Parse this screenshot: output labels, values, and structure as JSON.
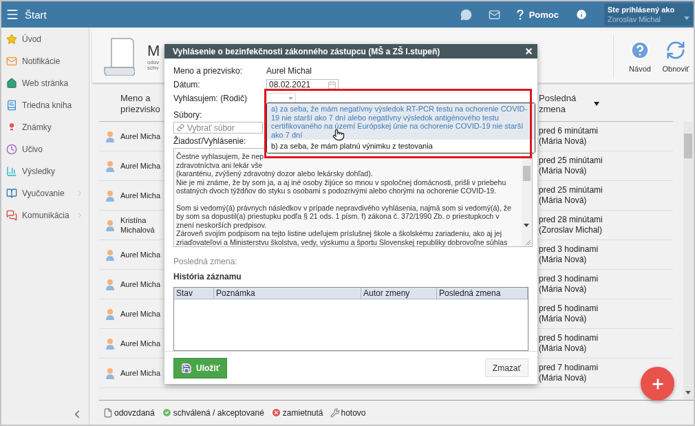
{
  "topbar": {
    "title": "Štart",
    "help_label": "Pomoc",
    "user_caption": "Ste prihlásený ako",
    "user_name": "Zoroslav Michal"
  },
  "sidebar": {
    "items": [
      {
        "label": "Úvod",
        "has_submenu": false
      },
      {
        "label": "Notifikácie",
        "has_submenu": false
      },
      {
        "label": "Web stránka",
        "has_submenu": false
      },
      {
        "label": "Triedna kniha",
        "has_submenu": false
      },
      {
        "label": "Známky",
        "has_submenu": false
      },
      {
        "label": "Učivo",
        "has_submenu": false
      },
      {
        "label": "Výsledky",
        "has_submenu": false
      },
      {
        "label": "Vyučovanie",
        "has_submenu": true
      },
      {
        "label": "Komunikácia",
        "has_submenu": true
      }
    ]
  },
  "page_header": {
    "title": "M",
    "description": [
      "odov",
      "schv"
    ]
  },
  "toolbar": {
    "buttons": [
      {
        "label": "Návod"
      },
      {
        "label": "Obnoviť"
      }
    ]
  },
  "list": {
    "columns": [
      "Meno a priezvisko",
      "Posledná zmena"
    ],
    "rows": [
      {
        "name": "Aurel Micha",
        "changed": "pred 6 minútami",
        "author": "(Mária Nová)"
      },
      {
        "name": "Aurel Micha",
        "changed": "pred 25 minútami",
        "author": "(Mária Nová)"
      },
      {
        "name": "Aurel Micha",
        "changed": "pred 25 minútami",
        "author": "(Mária Nová)"
      },
      {
        "name": "Kristína Michalová",
        "changed": "pred 28 minútami",
        "author": "(Zoroslav Michal)"
      },
      {
        "name": "Aurel Micha",
        "changed": "pred 3 hodinami",
        "author": "(Mária Nová)"
      },
      {
        "name": "Aurel Micha",
        "changed": "pred 3 hodinami",
        "author": "(Mária Nová)"
      },
      {
        "name": "Aurel Micha",
        "changed": "pred 5 hodinami",
        "author": "(Mária Nová)"
      },
      {
        "name": "Aurel Micha",
        "changed": "pred 5 hodinami",
        "author": "(Mária Nová)"
      },
      {
        "name": "Aurel Micha",
        "changed": "pred 7 hodinami",
        "author": "(Mária Nová)"
      }
    ]
  },
  "legend": [
    {
      "label": "odovzdaná"
    },
    {
      "label": "schválená / akceptované"
    },
    {
      "label": "zamietnutá"
    },
    {
      "label": "hotovo"
    }
  ],
  "dialog": {
    "title": "Vyhlásenie o bezinfekčnosti zákonného zástupcu (MŠ a ZŠ I.stupeň)",
    "name_label": "Meno a priezvisko:",
    "name_value": "Aurel Michal",
    "date_label": "Dátum:",
    "date_value": "08.02.2021",
    "declare_label": "Vyhlasujem: (Rodič)",
    "declare_options": [
      {
        "label": "a) za seba, že mám negatívny výsledok RT-PCR testu na ochorenie COVID-19 nie starší ako 7 dní alebo negatívny výsledok antigénového testu certifikovaného na území Európskej únie na ochorenie COVID-19 nie starší ako 7 dní",
        "selected": true
      },
      {
        "label": "b) za seba, že mám platnú výnimku z testovania",
        "selected": false
      }
    ],
    "files_label": "Súbory:",
    "files_placeholder": "Vybrať súbor",
    "request_label": "Žiadosť/Vyhlásenie:",
    "request_paragraphs": [
      {
        "lines": [
          "Čestne vyhlasujem, že nep",
          "zdravotníctva ani lekár vše",
          "(karanténu, zvýšený zdravotný dozor alebo lekársky dohľad).",
          "Nie je mi známe, že by som ja, a aj iné osoby žijúce so mnou v spoločnej domácnosti, prišli v priebehu",
          "ostatných dvoch týždňov do styku s osobami s podozrivými alebo chorými na ochorenie COVID-19."
        ]
      },
      {
        "lines": [
          "Som si vedomý(á) právnych následkov v prípade nepravdivého vyhlásenia, najmä som si vedomý(á), že",
          "by som sa dopustil(a) priestupku podľa § 21 ods. 1 písm. f) zákona č. 372/1990 Zb. o priestupkoch v",
          "znení neskorších predpisov.",
          "Zároveň svojím podpisom na tejto listine udeľujem príslušnej škole a školskému zariadeniu, ako aj jej",
          "zriaďovateľovi a Ministerstvu školstva, vedy, výskumu a športu Slovenskej republiky dobrovoľne súhlas"
        ]
      }
    ],
    "last_change_label": "Posledná zmena:",
    "history_title": "História záznamu",
    "history_columns": [
      "Stav",
      "Poznámka",
      "Autor zmeny",
      "Posledná zmena"
    ],
    "save_label": "Uložiť",
    "delete_label": "Zmazať"
  }
}
